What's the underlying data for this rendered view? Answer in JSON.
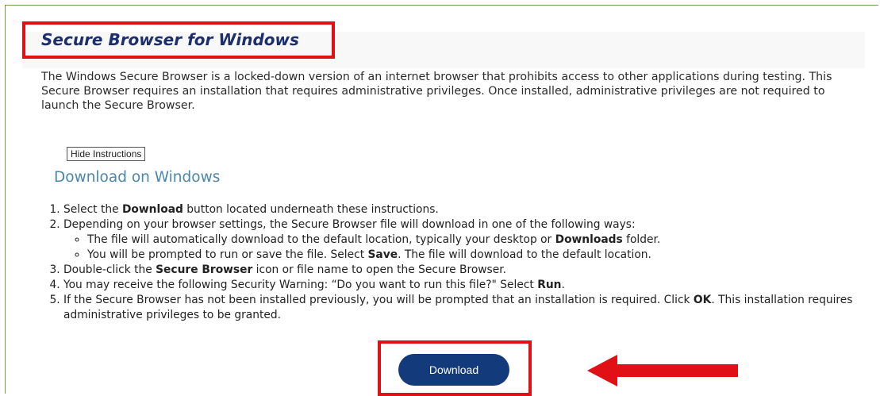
{
  "header": {
    "title": "Secure Browser for Windows"
  },
  "intro": {
    "text": "The Windows Secure Browser is a locked-down version of an internet browser that prohibits access to other applications during testing. This Secure Browser requires an installation that requires administrative privileges. Once installed, administrative privileges are not required to launch the Secure Browser."
  },
  "instructions": {
    "toggle_label": "Hide Instructions",
    "heading": "Download on Windows",
    "step1": {
      "pre": "Select the ",
      "bold": "Download",
      "post": " button located underneath these instructions."
    },
    "step2": {
      "text": "Depending on your browser settings, the Secure Browser file will download in one of the following ways:",
      "sub1": {
        "pre": "The file will automatically download to the default location, typically your desktop or ",
        "bold": "Downloads",
        "post": " folder."
      },
      "sub2": {
        "pre": "You will be prompted to run or save the file. Select ",
        "bold": "Save",
        "post": ". The file will download to the default location."
      }
    },
    "step3": {
      "pre": "Double-click the ",
      "bold": "Secure Browser",
      "post": " icon or file name to open the Secure Browser."
    },
    "step4": {
      "pre": "You may receive the following Security Warning: “Do you want to run this file?\" Select ",
      "bold": "Run",
      "post": "."
    },
    "step5": {
      "pre": "If the Secure Browser has not been installed previously, you will be prompted that an installation is required. Click ",
      "bold": "OK",
      "post": ". This installation requires administrative privileges to be granted."
    }
  },
  "download": {
    "label": "Download"
  },
  "colors": {
    "annotation_red": "#e11016",
    "title_navy": "#1b2f6e",
    "heading_blue": "#4a87a8",
    "button_navy": "#133a7a",
    "frame_green": "#6b9a4a"
  },
  "icons": {
    "pointer": "red-arrow-icon"
  }
}
